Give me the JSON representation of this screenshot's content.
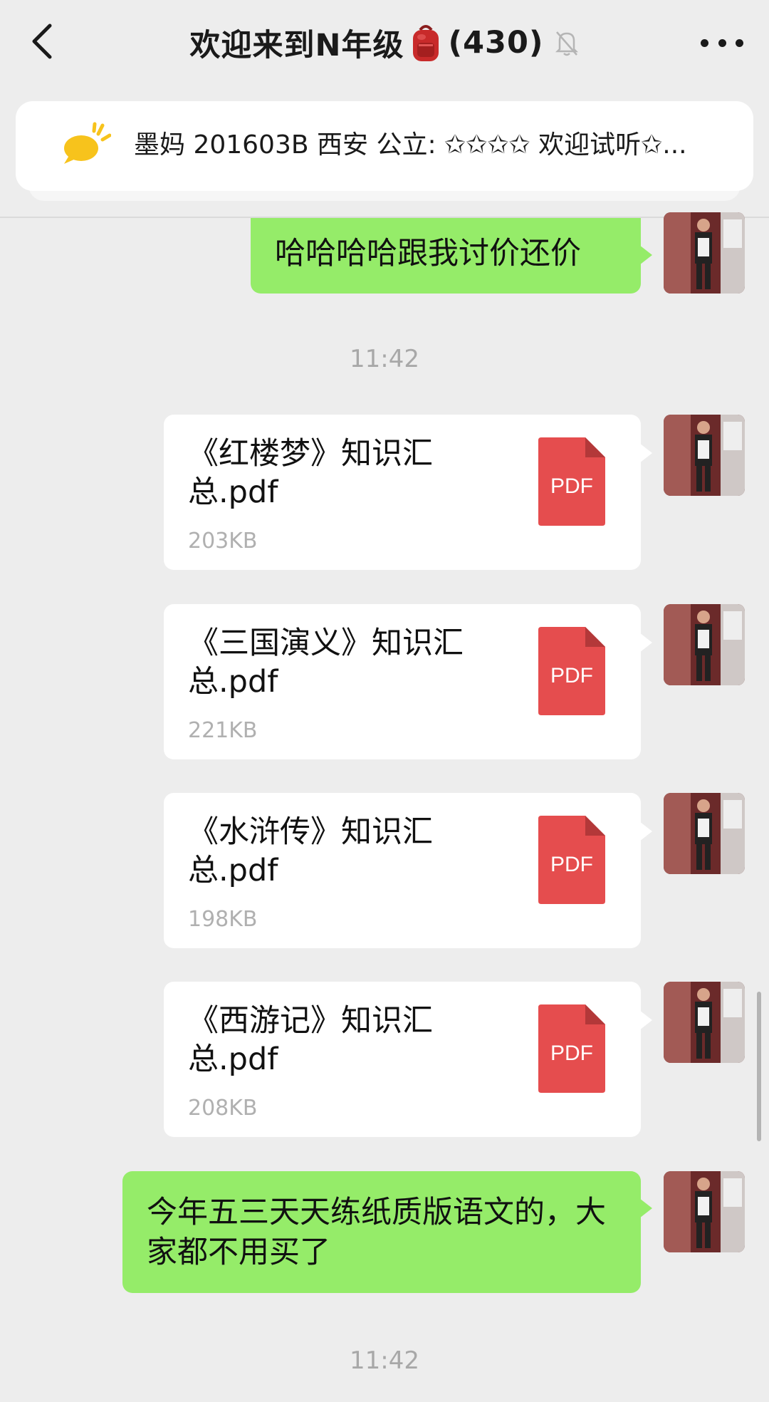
{
  "header": {
    "title": "欢迎来到N年级",
    "member_count": "(430)",
    "backpack_emoji": "🎒"
  },
  "notice": {
    "text": "墨妈 201603B 西安 公立: ✩✩✩✩ 欢迎试听✩..."
  },
  "messages": [
    {
      "type": "text",
      "text": "哈哈哈哈跟我讨价还价"
    },
    {
      "type": "time",
      "text": "11:42"
    },
    {
      "type": "file",
      "name": "《红楼梦》知识汇总.pdf",
      "size": "203KB",
      "icon_label": "PDF"
    },
    {
      "type": "file",
      "name": "《三国演义》知识汇总.pdf",
      "size": "221KB",
      "icon_label": "PDF"
    },
    {
      "type": "file",
      "name": "《水浒传》知识汇总.pdf",
      "size": "198KB",
      "icon_label": "PDF"
    },
    {
      "type": "file",
      "name": "《西游记》知识汇总.pdf",
      "size": "208KB",
      "icon_label": "PDF"
    },
    {
      "type": "text",
      "text": "今年五三天天练纸质版语文的，大家都不用买了"
    },
    {
      "type": "time",
      "text": "11:42"
    }
  ],
  "icons": {
    "back": "chevron-left-icon",
    "mute": "bell-slash-icon",
    "more": "more-dots-icon",
    "notice": "speech-bubble-icon",
    "file": "pdf-file-icon"
  },
  "colors": {
    "background": "#ededed",
    "sent_bubble": "#95ec69",
    "pdf_red": "#e54d4e",
    "notice_icon": "#f7c31c"
  }
}
